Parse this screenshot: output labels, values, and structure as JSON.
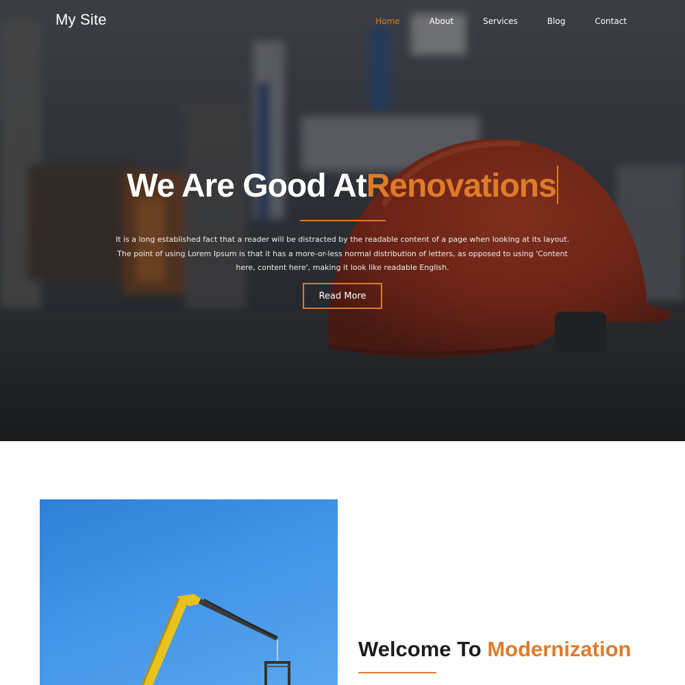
{
  "site": {
    "brand": "My Site"
  },
  "nav": {
    "items": [
      {
        "label": "Home",
        "active": true
      },
      {
        "label": "About",
        "active": false
      },
      {
        "label": "Services",
        "active": false
      },
      {
        "label": "Blog",
        "active": false
      },
      {
        "label": "Contact",
        "active": false
      }
    ]
  },
  "hero": {
    "title_prefix": "We Are Good At",
    "title_accent": "Renovations",
    "description": "It is a long established fact that a reader will be distracted by the readable content of a page when looking at its layout. The point of using Lorem Ipsum is that it has a more-or-less normal distribution of letters, as opposed to using 'Content here, content here', making it look like readable English.",
    "button_label": "Read More",
    "background_image": "red-hard-hat-on-asphalt"
  },
  "about": {
    "title_prefix": "Welcome To",
    "title_accent": "Modernization",
    "image": "yellow-crane-blue-sky"
  },
  "colors": {
    "accent": "#e07b2a",
    "text_dark": "#1c1c1c",
    "hero_text": "#ffffff"
  }
}
